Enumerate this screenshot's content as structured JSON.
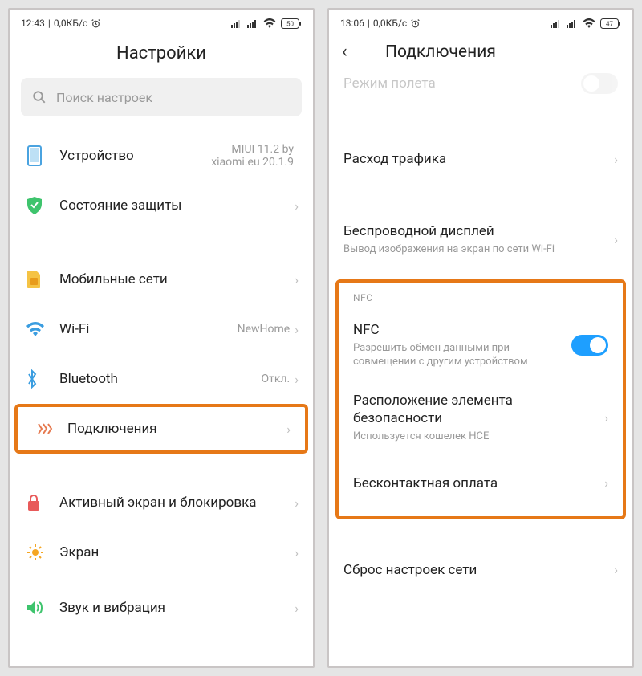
{
  "left": {
    "status": {
      "time": "12:43",
      "speed": "0,0КБ/с",
      "battery": "50"
    },
    "title": "Настройки",
    "search_placeholder": "Поиск настроек",
    "items": [
      {
        "label": "Устройство",
        "meta": "MIUI 11.2 by xiaomi.eu 20.1.9"
      },
      {
        "label": "Состояние защиты"
      },
      {
        "label": "Мобильные сети"
      },
      {
        "label": "Wi-Fi",
        "meta": "NewHome"
      },
      {
        "label": "Bluetooth",
        "meta": "Откл."
      },
      {
        "label": "Подключения"
      },
      {
        "label": "Активный экран и блокировка"
      },
      {
        "label": "Экран"
      },
      {
        "label": "Звук и вибрация"
      }
    ]
  },
  "right": {
    "status": {
      "time": "13:06",
      "speed": "0,0КБ/с",
      "battery": "47"
    },
    "title": "Подключения",
    "partial": "Режим полета",
    "items": [
      {
        "label": "Расход трафика"
      },
      {
        "label": "Беспроводной дисплей",
        "sub": "Вывод изображения на экран по сети Wi-Fi"
      }
    ],
    "nfc_header": "NFC",
    "nfc": {
      "label": "NFC",
      "sub": "Разрешить обмен данными при совмещении с другим устройством",
      "sec_label": "Расположение элемента безопасности",
      "sec_sub": "Используется кошелек HCE",
      "pay_label": "Бесконтактная оплата"
    },
    "reset": "Сброс настроек сети"
  }
}
